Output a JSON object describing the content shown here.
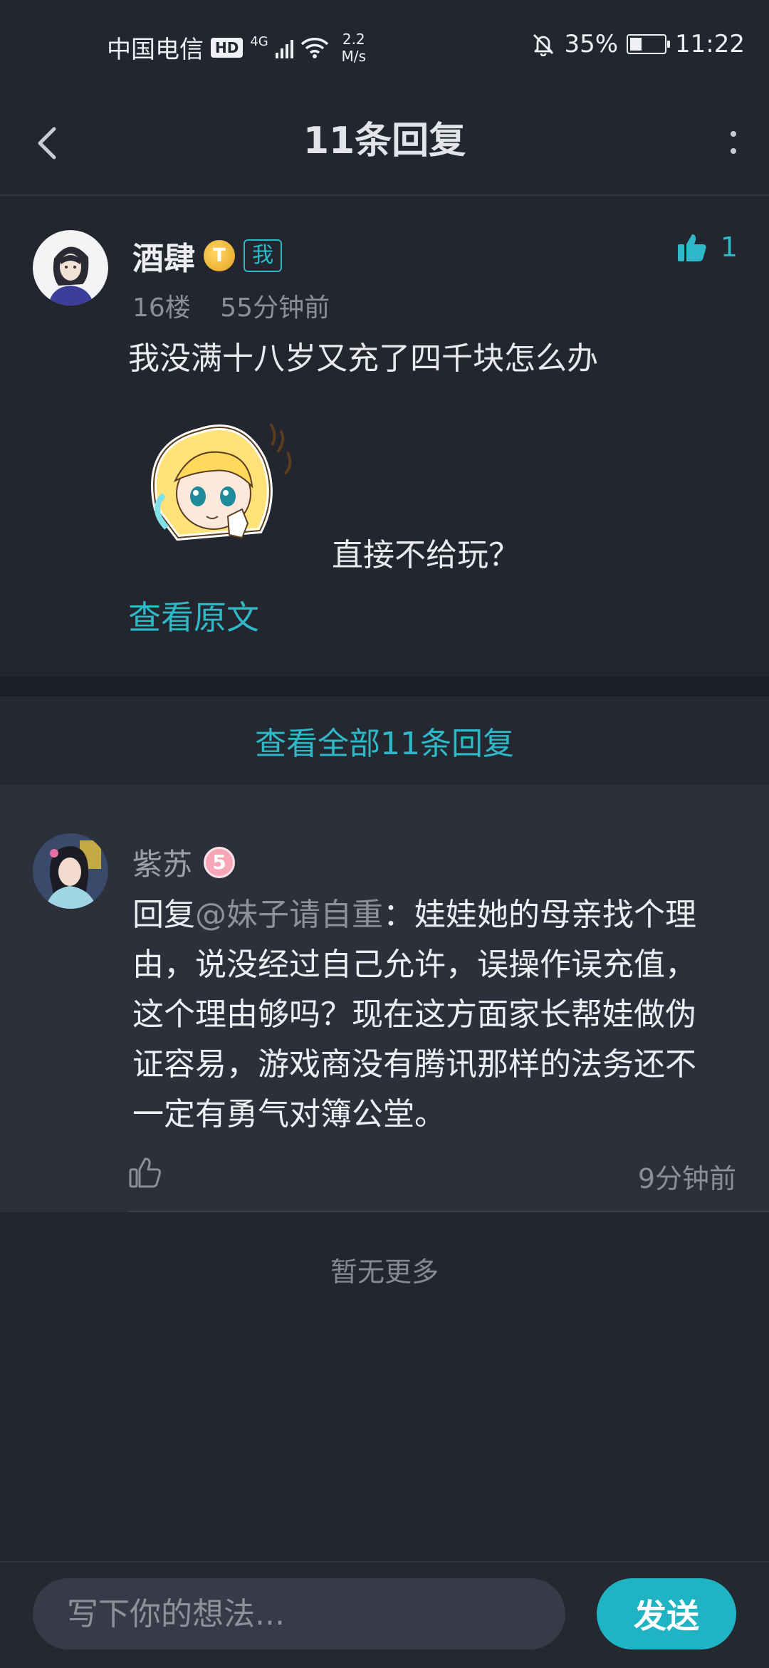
{
  "status_bar": {
    "carrier": "中国电信",
    "hd": "HD",
    "network": "4G",
    "speed_value": "2.2",
    "speed_unit": "M/s",
    "battery": "35%",
    "battery_level": 0.35,
    "time": "11:22"
  },
  "header": {
    "title": "11条回复"
  },
  "post": {
    "author": "酒肆",
    "level_badge": "T",
    "me_tag": "我",
    "likes": "1",
    "floor": "16楼",
    "time_ago": "55分钟前",
    "text": "我没满十八岁又充了四千块怎么办",
    "text_after_sticker": "直接不给玩？",
    "view_original": "查看原文"
  },
  "view_all": "查看全部11条回复",
  "reply": {
    "author": "紫苏",
    "level_badge": "5",
    "prefix": "回复",
    "mention": "@妹子请自重",
    "colon": "：",
    "text": "娃娃她的母亲找个理由，说没经过自己允许，误操作误充值，这个理由够吗？现在这方面家长帮娃做伪证容易，游戏商没有腾讯那样的法务还不一定有勇气对簿公堂。",
    "time_ago": "9分钟前"
  },
  "no_more": "暂无更多",
  "composer": {
    "placeholder": "写下你的想法...",
    "send_label": "发送"
  },
  "colors": {
    "accent": "#2fb8c8",
    "send_button": "#1fb3c3",
    "background": "#22262f",
    "reply_background": "#2c303b"
  },
  "icons": {
    "back": "chevron-left-icon",
    "more": "more-vertical-icon",
    "like": "thumbs-up-icon",
    "mute": "bell-off-icon",
    "wifi": "wifi-icon",
    "signal": "signal-icon",
    "battery": "battery-charging-icon"
  }
}
